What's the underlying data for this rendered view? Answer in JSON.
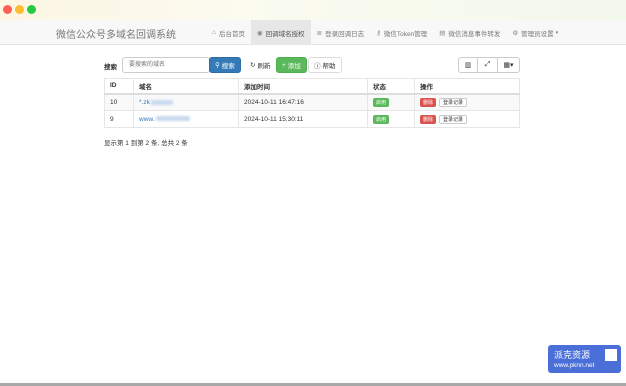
{
  "window": {
    "brand": "微信公众号多域名回调系统"
  },
  "nav": {
    "items": [
      {
        "label": "后台首页",
        "icon": "home-icon",
        "glyph": "⌂"
      },
      {
        "label": "回调域名授权",
        "icon": "globe-icon",
        "glyph": "◉"
      },
      {
        "label": "登录回调日志",
        "icon": "list-icon",
        "glyph": "≣"
      },
      {
        "label": "微信Token管理",
        "icon": "key-icon",
        "glyph": "⚷"
      },
      {
        "label": "微信消息事件转发",
        "icon": "list-alt-icon",
        "glyph": "▤"
      },
      {
        "label": "管理员设置",
        "icon": "gear-icon",
        "glyph": "⚙"
      }
    ]
  },
  "toolbar": {
    "search_label": "搜索",
    "search_placeholder": "要搜索的域名",
    "search_button": "搜索",
    "refresh_button": "刷新",
    "add_button": "添加",
    "help_button": "帮助"
  },
  "table": {
    "headers": [
      "ID",
      "域名",
      "添加时间",
      "状态",
      "操作"
    ],
    "rows": [
      {
        "id": "10",
        "domain": "*.zk",
        "time": "2024-10-11 16:47:16",
        "status": "启用",
        "delete": "删除",
        "log": "登录记录"
      },
      {
        "id": "9",
        "domain": "www.",
        "time": "2024-10-11 15:30:11",
        "status": "启用",
        "delete": "删除",
        "log": "登录记录"
      }
    ]
  },
  "pager": {
    "text": "显示第 1 到第 2 条, 总共 2 条"
  },
  "watermark": {
    "title": "派克资源",
    "url": "www.pknn.net"
  },
  "colors": {
    "primary": "#337ab7",
    "success": "#5cb85c",
    "danger": "#d9534f"
  }
}
